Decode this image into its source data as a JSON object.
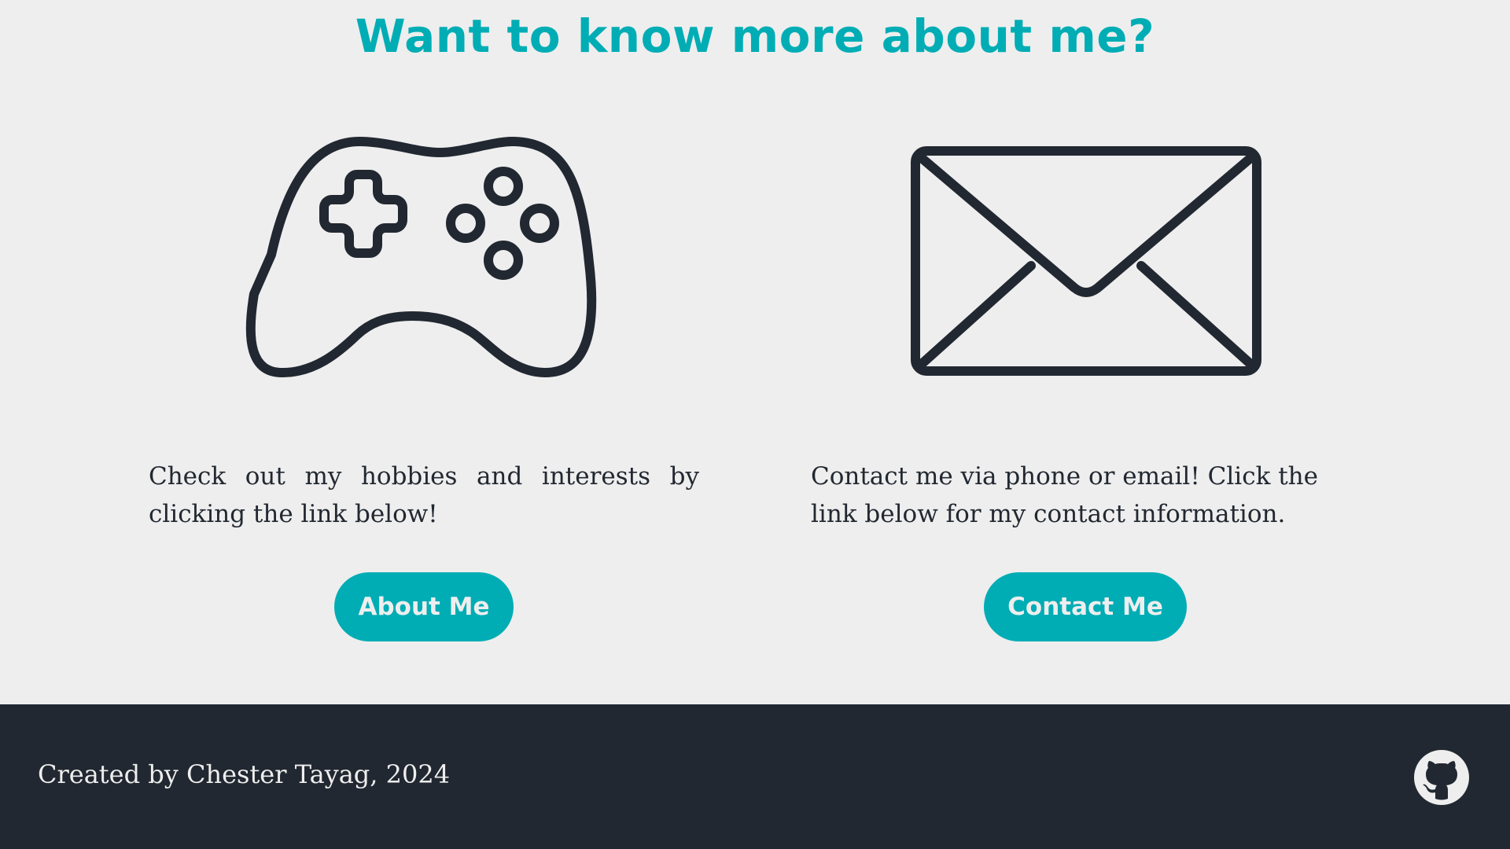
{
  "header": {
    "title": "Want to know more about me?"
  },
  "cards": [
    {
      "icon": "gamepad-icon",
      "text": "Check out my hobbies and interests by clicking the link below!",
      "button_label": "About Me"
    },
    {
      "icon": "envelope-icon",
      "text": "Contact me via phone or email! Click the link below for my contact information.",
      "button_label": "Contact Me"
    }
  ],
  "footer": {
    "credit": "Created by Chester Tayag, 2024",
    "social_icon": "github-icon"
  },
  "colors": {
    "accent": "#00adb5",
    "dark": "#222831",
    "background": "#eeeeee"
  }
}
